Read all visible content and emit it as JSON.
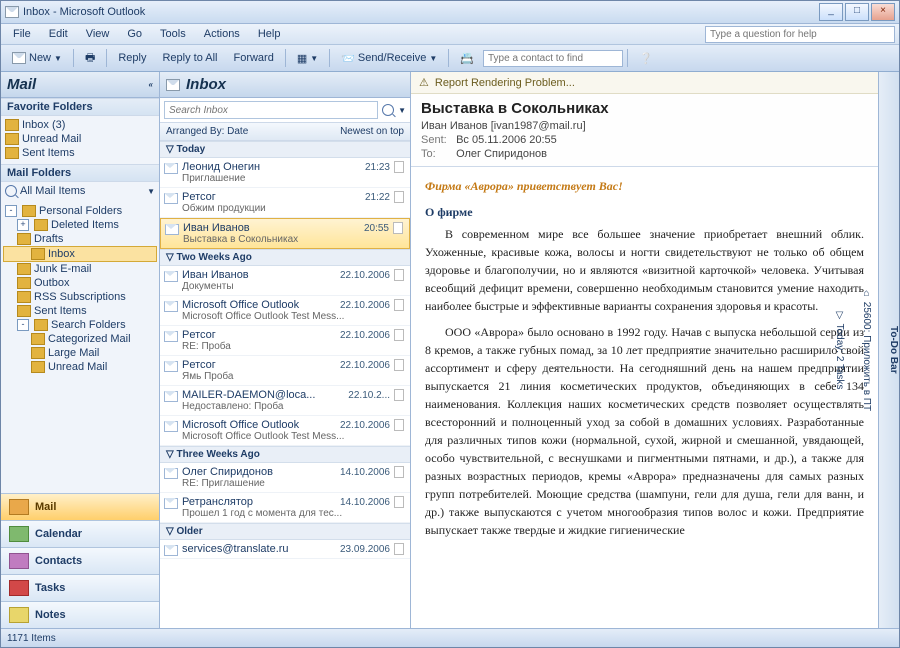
{
  "window": {
    "title": "Inbox - Microsoft Outlook"
  },
  "menu": [
    "File",
    "Edit",
    "View",
    "Go",
    "Tools",
    "Actions",
    "Help"
  ],
  "help_placeholder": "Type a question for help",
  "toolbar": {
    "new": "New",
    "reply": "Reply",
    "reply_all": "Reply to All",
    "forward": "Forward",
    "send_receive": "Send/Receive",
    "contact_placeholder": "Type a contact to find"
  },
  "nav": {
    "title": "Mail",
    "fav_label": "Favorite Folders",
    "fav": [
      {
        "label": "Inbox (3)"
      },
      {
        "label": "Unread Mail"
      },
      {
        "label": "Sent Items"
      }
    ],
    "mail_label": "Mail Folders",
    "all_items": "All Mail Items",
    "tree": [
      {
        "label": "Personal Folders",
        "indent": 0,
        "exp": "-"
      },
      {
        "label": "Deleted Items",
        "indent": 1,
        "exp": "+"
      },
      {
        "label": "Drafts",
        "indent": 1
      },
      {
        "label": "Inbox",
        "indent": 1,
        "sel": true
      },
      {
        "label": "Junk E-mail",
        "indent": 1
      },
      {
        "label": "Outbox",
        "indent": 1
      },
      {
        "label": "RSS Subscriptions",
        "indent": 1
      },
      {
        "label": "Sent Items",
        "indent": 1
      },
      {
        "label": "Search Folders",
        "indent": 1,
        "exp": "-"
      },
      {
        "label": "Categorized Mail",
        "indent": 2
      },
      {
        "label": "Large Mail",
        "indent": 2
      },
      {
        "label": "Unread Mail",
        "indent": 2
      }
    ],
    "buttons": [
      {
        "label": "Mail",
        "cls": "nb-mail",
        "active": true
      },
      {
        "label": "Calendar",
        "cls": "nb-cal"
      },
      {
        "label": "Contacts",
        "cls": "nb-contacts"
      },
      {
        "label": "Tasks",
        "cls": "nb-tasks"
      },
      {
        "label": "Notes",
        "cls": "nb-notes"
      }
    ]
  },
  "list": {
    "title": "Inbox",
    "search_placeholder": "Search Inbox",
    "arrange": "Arranged By: Date",
    "sort": "Newest on top",
    "groups": [
      {
        "label": "Today",
        "items": [
          {
            "from": "Леонид Онегин",
            "date": "21:23",
            "subj": "Приглашение"
          },
          {
            "from": "Pетсог",
            "date": "21:22",
            "subj": "Обжим продукции"
          },
          {
            "from": "Иван Иванов",
            "date": "20:55",
            "subj": "Выставка в Сокольниках",
            "sel": true
          }
        ]
      },
      {
        "label": "Two Weeks Ago",
        "items": [
          {
            "from": "Иван Иванов",
            "date": "22.10.2006",
            "subj": "Документы"
          },
          {
            "from": "Microsoft Office Outlook",
            "date": "22.10.2006",
            "subj": "Microsoft Office Outlook Test Mess..."
          },
          {
            "from": "Pетсог",
            "date": "22.10.2006",
            "subj": "RE: Проба"
          },
          {
            "from": "Pетсог",
            "date": "22.10.2006",
            "subj": "Ямь Проба"
          },
          {
            "from": "MAILER-DAEMON@loca...",
            "date": "22.10.2...",
            "subj": "Недоставлено: Проба"
          },
          {
            "from": "Microsoft Office Outlook",
            "date": "22.10.2006",
            "subj": "Microsoft Office Outlook Test Mess..."
          }
        ]
      },
      {
        "label": "Three Weeks Ago",
        "items": [
          {
            "from": "Олег Спиридонов",
            "date": "14.10.2006",
            "subj": "RE: Приглашение"
          },
          {
            "from": "Ретранслятор",
            "date": "14.10.2006",
            "subj": "Прошел 1 год с момента для тес..."
          }
        ]
      },
      {
        "label": "Older",
        "items": [
          {
            "from": "services@translate.ru",
            "date": "23.09.2006",
            "subj": ""
          }
        ]
      }
    ]
  },
  "reading": {
    "banner": "Report Rendering Problem...",
    "subject": "Выставка в Сокольниках",
    "from": "Иван Иванов [ivan1987@mail.ru]",
    "sent_label": "Sent:",
    "sent_value": "Вс 05.11.2006 20:55",
    "to_label": "To:",
    "to_value": "Олег Спиридонов",
    "greet": "Фирма «Аврора» приветствует Вас!",
    "section_head": "О фирме",
    "p1": "В современном мире все большее значение приобретает внешний облик. Ухоженные, красивые кожа, волосы и ногти свидетельствуют не только об общем здоровье и благополучии, но и являются «визитной карточкой» человека. Учитывая всеобщий дефицит времени, совершенно необходимым становится умение находить наиболее быстрые и эффективные варианты сохранения здоровья и красоты.",
    "p2": "ООО «Аврора» было основано в 1992 году. Начав с выпуска небольшой серии из 8 кремов, а также губных помад, за 10 лет предприятие значительно расширило свой ассортимент и сферу деятельности. На сегодняшний день на нашем предприятии выпускается 21 линия косметических продуктов, объединяющих в себе 134 наименования. Коллекция наших косметических средств позволяет осуществлять всесторонний и полноценный уход за собой в домашних условиях. Разработанные для различных типов кожи (нормальной, сухой, жирной и смешанной, увядающей, особо чувствительной, с веснушками и пигментными пятнами, и др.), а также для разных возрастных периодов, кремы «Аврора» предназначены для самых разных групп потребителей. Моющие средства (шампуни, гели для душа, гели для ванн, и др.) также выпускаются с учетом многообразия типов волос и кожи. Предприятие выпускает также твердые и жидкие гигиенические"
  },
  "todo": {
    "title": "To-Do Bar",
    "date_line": "⌂ 25600: Приложить в ПТ",
    "today_line": "▽ Today: 2 Tasks"
  },
  "status": {
    "items": "1171 Items"
  }
}
